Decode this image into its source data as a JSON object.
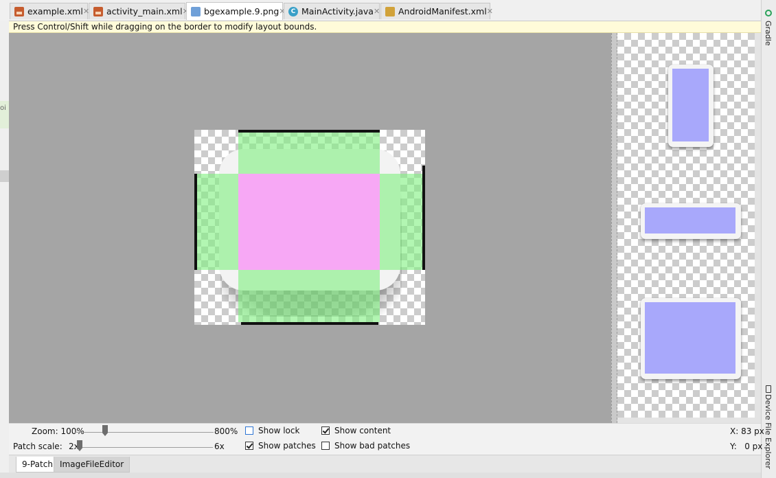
{
  "tabs": [
    {
      "label": "example.xml",
      "icon": "xml-file-icon",
      "active": false
    },
    {
      "label": "activity_main.xml",
      "icon": "xml-file-icon",
      "active": false
    },
    {
      "label": "bgexample.9.png",
      "icon": "image-file-icon",
      "active": true
    },
    {
      "label": "MainActivity.java",
      "icon": "java-class-icon",
      "active": false
    },
    {
      "label": "AndroidManifest.xml",
      "icon": "manifest-file-icon",
      "active": false
    }
  ],
  "tab_close_glyph": "✕",
  "hint": "Press Control/Shift while dragging on the border to modify layout bounds.",
  "left_fragment": "oi",
  "right_tools": {
    "gradle": "Gradle",
    "device_file_explorer": "Device File Explorer"
  },
  "controls": {
    "zoom_label": "Zoom: 100%",
    "zoom_max": "800%",
    "patch_scale_label": "Patch scale:",
    "patch_scale_min": "2x",
    "patch_scale_max": "6x",
    "show_lock": {
      "label": "Show lock",
      "checked": false
    },
    "show_content": {
      "label": "Show content",
      "checked": true
    },
    "show_patches": {
      "label": "Show patches",
      "checked": true
    },
    "show_bad_patches": {
      "label": "Show bad patches",
      "checked": false
    },
    "x_readout": "X: 83 px",
    "y_readout": "Y:   0 px"
  },
  "bottom_tabs": [
    {
      "label": "9-Patch",
      "active": true
    },
    {
      "label": "ImageFileEditor",
      "active": false
    }
  ],
  "colors": {
    "patch_stretch": "#a6f7a6",
    "patch_content": "#f7a8f5",
    "preview_content": "#a8a8fb",
    "editor_bg": "#a5a5a5",
    "hint_bg": "#fffbd9"
  }
}
